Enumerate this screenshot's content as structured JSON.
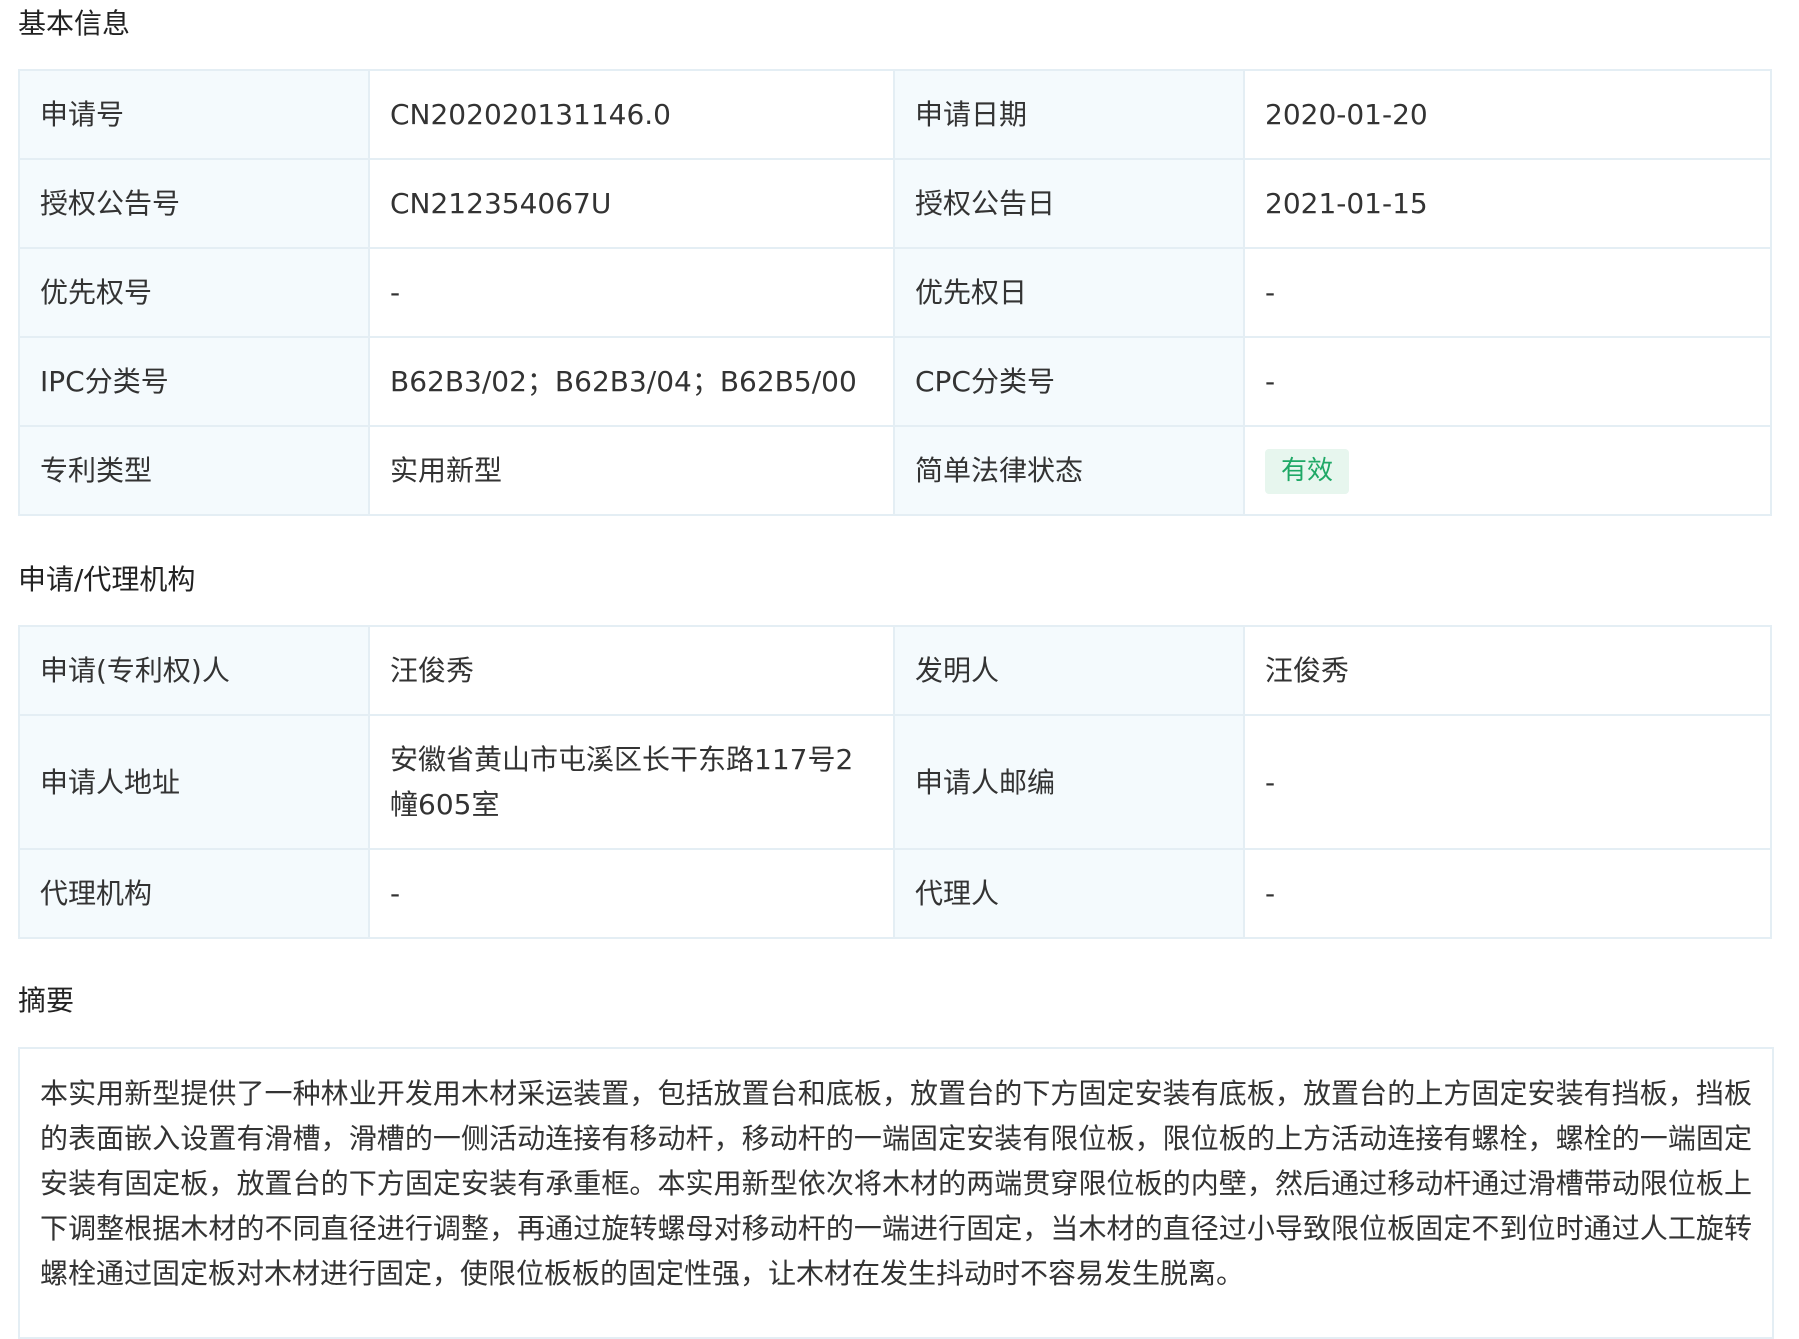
{
  "sections": {
    "basic_info": "基本信息",
    "applicant_agency": "申请/代理机构",
    "abstract": "摘要"
  },
  "basic": {
    "app_no_label": "申请号",
    "app_no": "CN202020131146.0",
    "app_date_label": "申请日期",
    "app_date": "2020-01-20",
    "grant_no_label": "授权公告号",
    "grant_no": "CN212354067U",
    "grant_date_label": "授权公告日",
    "grant_date": "2021-01-15",
    "priority_no_label": "优先权号",
    "priority_no": "-",
    "priority_date_label": "优先权日",
    "priority_date": "-",
    "ipc_label": "IPC分类号",
    "ipc": "B62B3/02；B62B3/04；B62B5/00",
    "cpc_label": "CPC分类号",
    "cpc": "-",
    "type_label": "专利类型",
    "type": "实用新型",
    "status_label": "简单法律状态",
    "status": "有效"
  },
  "agency": {
    "applicant_label": "申请(专利权)人",
    "applicant": "汪俊秀",
    "inventor_label": "发明人",
    "inventor": "汪俊秀",
    "address_label": "申请人地址",
    "address": "安徽省黄山市屯溪区长干东路117号2幢605室",
    "zip_label": "申请人邮编",
    "zip": "-",
    "agency_label": "代理机构",
    "agency": "-",
    "agent_label": "代理人",
    "agent": "-"
  },
  "abstract_text": "本实用新型提供了一种林业开发用木材采运装置，包括放置台和底板，放置台的下方固定安装有底板，放置台的上方固定安装有挡板，挡板的表面嵌入设置有滑槽，滑槽的一侧活动连接有移动杆，移动杆的一端固定安装有限位板，限位板的上方活动连接有螺栓，螺栓的一端固定安装有固定板，放置台的下方固定安装有承重框。本实用新型依次将木材的两端贯穿限位板的内壁，然后通过移动杆通过滑槽带动限位板上下调整根据木材的不同直径进行调整，再通过旋转螺母对移动杆的一端进行固定，当木材的直径过小导致限位板固定不到位时通过人工旋转螺栓通过固定板对木材进行固定，使限位板板的固定性强，让木材在发生抖动时不容易发生脱离。",
  "colors": {
    "label_bg": "#f4fafd",
    "border": "#e4eef4",
    "badge_bg": "#e7f6ee",
    "badge_text": "#1fa866"
  }
}
